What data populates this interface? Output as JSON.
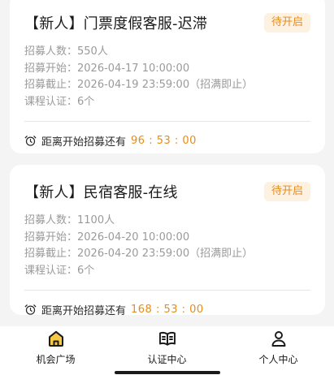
{
  "cards": [
    {
      "title": "【新人】门票度假客服-迟滞",
      "badge": "待开启",
      "recruit_count_label": "招募人数：",
      "recruit_count": "550人",
      "start_label": "招募开始：",
      "start": "2026-04-17 10:00:00",
      "end_label": "招募截止：",
      "end": "2026-04-19 23:59:00（招满即止）",
      "course_label": "课程认证：",
      "course": "6个",
      "countdown_label": "距离开始招募还有",
      "countdown": "96 : 53 : 00"
    },
    {
      "title": "【新人】民宿客服-在线",
      "badge": "待开启",
      "recruit_count_label": "招募人数：",
      "recruit_count": "1100人",
      "start_label": "招募开始：",
      "start": "2026-04-20 10:00:00",
      "end_label": "招募截止：",
      "end": "2026-04-20 23:59:00（招满即止）",
      "course_label": "课程认证：",
      "course": "6个",
      "countdown_label": "距离开始招募还有",
      "countdown": "168 : 53 : 00"
    }
  ],
  "tabbar": {
    "items": [
      {
        "label": "机会广场",
        "icon": "home-icon",
        "active": true
      },
      {
        "label": "认证中心",
        "icon": "book-icon",
        "active": false
      },
      {
        "label": "个人中心",
        "icon": "person-icon",
        "active": false
      }
    ]
  },
  "colors": {
    "accent": "#e48d1c",
    "badge_bg": "#fdf1e2",
    "active_icon_fill": "#f7c948",
    "background": "#f4f4f4"
  }
}
